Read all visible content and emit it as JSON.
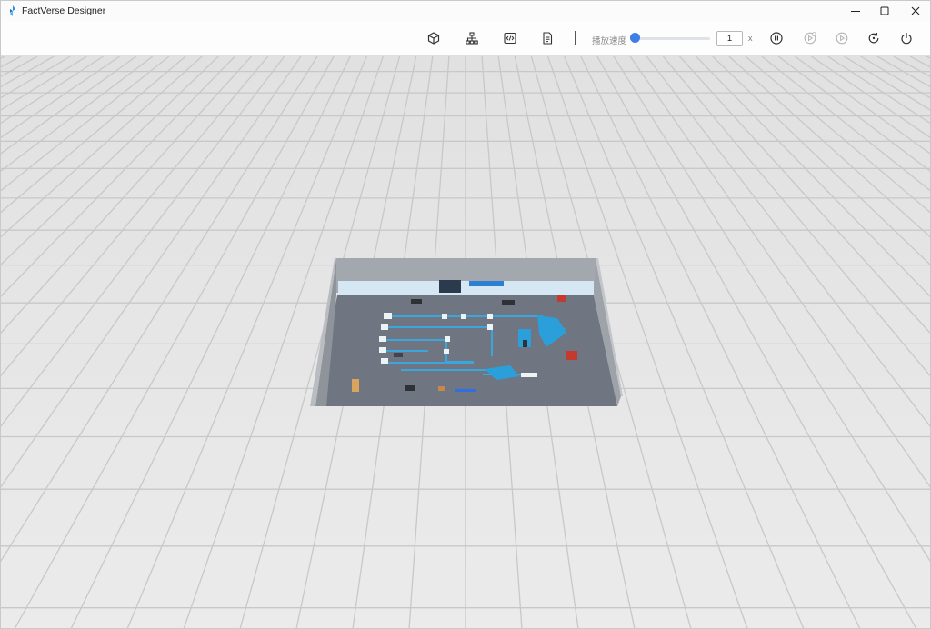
{
  "window": {
    "title": "FactVerse Designer"
  },
  "controls": {
    "minimize": "minimize",
    "maximize": "maximize",
    "close": "close"
  },
  "toolbar": {
    "tools": [
      {
        "name": "model",
        "icon": "cube-icon"
      },
      {
        "name": "hierarchy",
        "icon": "hierarchy-icon"
      },
      {
        "name": "script",
        "icon": "code-icon"
      },
      {
        "name": "document",
        "icon": "document-icon"
      }
    ],
    "speed_label": "播放速度",
    "speed_value": "1",
    "speed_unit": "x",
    "speed_fraction": 0.02,
    "playback": [
      {
        "name": "pause",
        "icon": "pause-icon",
        "enabled": true
      },
      {
        "name": "step-settings",
        "icon": "play-settings-icon",
        "enabled": false
      },
      {
        "name": "play",
        "icon": "play-icon",
        "enabled": false
      },
      {
        "name": "reset",
        "icon": "reset-icon",
        "enabled": true
      },
      {
        "name": "power",
        "icon": "power-icon",
        "enabled": true
      }
    ]
  },
  "colors": {
    "accent": "#3f7ee8",
    "floor": "#6e7480",
    "wall": "#a9adb3",
    "conveyor": "#2ea3d8"
  }
}
